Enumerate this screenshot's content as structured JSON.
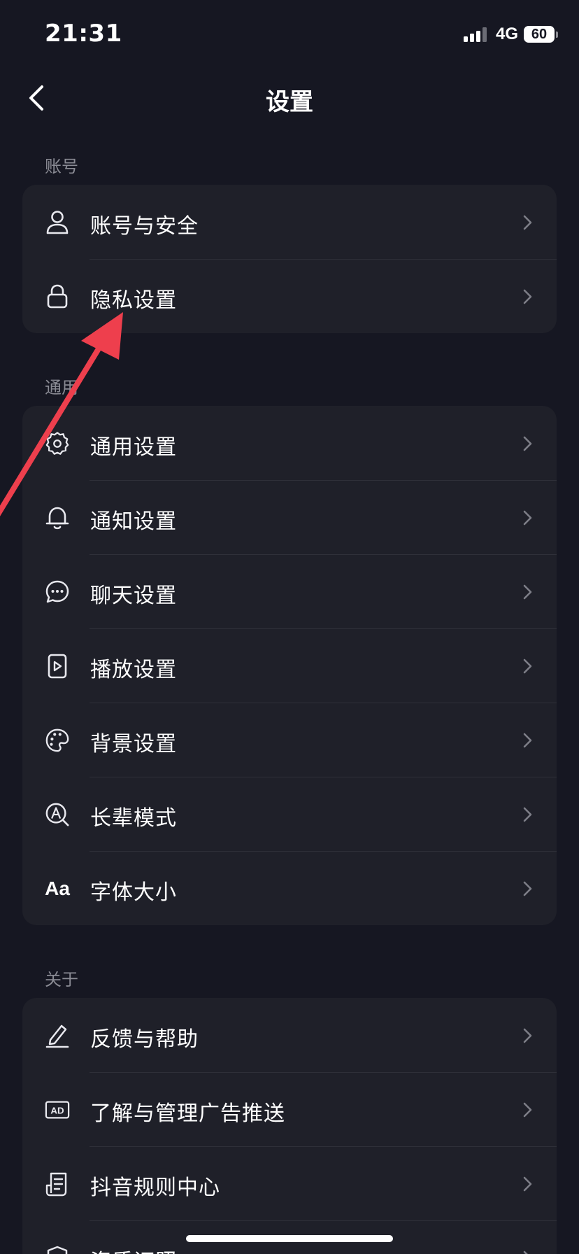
{
  "status_bar": {
    "time": "21:31",
    "network": "4G",
    "battery": "60"
  },
  "header": {
    "title": "设置"
  },
  "sections": [
    {
      "label": "账号",
      "items": [
        {
          "label": "账号与安全",
          "icon": "person-icon"
        },
        {
          "label": "隐私设置",
          "icon": "lock-icon"
        }
      ]
    },
    {
      "label": "通用",
      "items": [
        {
          "label": "通用设置",
          "icon": "gear-icon"
        },
        {
          "label": "通知设置",
          "icon": "bell-icon"
        },
        {
          "label": "聊天设置",
          "icon": "chat-bubble-icon"
        },
        {
          "label": "播放设置",
          "icon": "play-icon"
        },
        {
          "label": "背景设置",
          "icon": "palette-icon"
        },
        {
          "label": "长辈模式",
          "icon": "elder-mode-icon"
        },
        {
          "label": "字体大小",
          "icon": "font-size-icon",
          "icon_text": "Aa"
        }
      ]
    },
    {
      "label": "关于",
      "items": [
        {
          "label": "反馈与帮助",
          "icon": "pencil-icon"
        },
        {
          "label": "了解与管理广告推送",
          "icon": "ad-icon",
          "icon_text": "AD"
        },
        {
          "label": "抖音规则中心",
          "icon": "document-icon"
        },
        {
          "label": "资质证照",
          "icon": "shield-icon"
        }
      ]
    }
  ],
  "colors": {
    "background": "#161722",
    "card": "#1f2029",
    "divider": "#2f3039",
    "annotation_arrow": "#ee3f4d"
  }
}
